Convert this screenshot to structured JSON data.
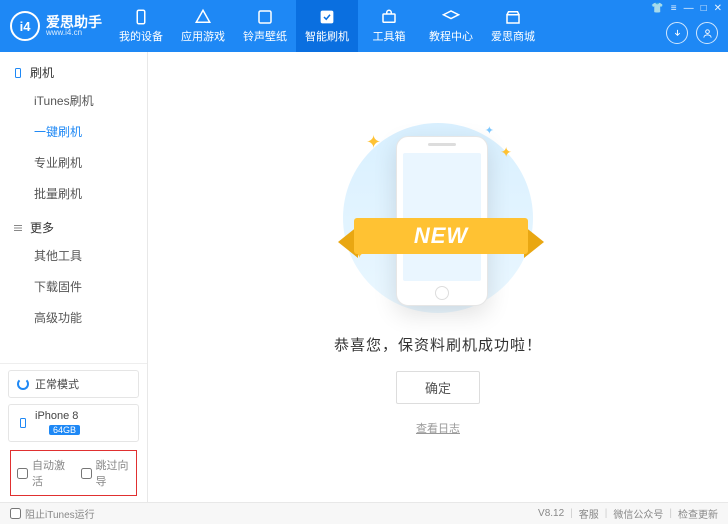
{
  "brand": {
    "title": "爱思助手",
    "sub": "www.i4.cn",
    "logo_text": "i4"
  },
  "nav": {
    "items": [
      {
        "label": "我的设备"
      },
      {
        "label": "应用游戏"
      },
      {
        "label": "铃声壁纸"
      },
      {
        "label": "智能刷机"
      },
      {
        "label": "工具箱"
      },
      {
        "label": "教程中心"
      },
      {
        "label": "爱思商城"
      }
    ]
  },
  "sidebar": {
    "group1": {
      "title": "刷机"
    },
    "items1": [
      {
        "label": "iTunes刷机"
      },
      {
        "label": "一键刷机"
      },
      {
        "label": "专业刷机"
      },
      {
        "label": "批量刷机"
      }
    ],
    "group2": {
      "title": "更多"
    },
    "items2": [
      {
        "label": "其他工具"
      },
      {
        "label": "下载固件"
      },
      {
        "label": "高级功能"
      }
    ],
    "mode_label": "正常模式",
    "device": {
      "name": "iPhone 8",
      "storage": "64GB"
    },
    "auto_activate": "自动激活",
    "skip_guide": "跳过向导"
  },
  "main": {
    "ribbon": "NEW",
    "message": "恭喜您，保资料刷机成功啦！",
    "ok": "确定",
    "view_log": "查看日志"
  },
  "footer": {
    "block_itunes": "阻止iTunes运行",
    "version": "V8.12",
    "support": "客服",
    "wechat": "微信公众号",
    "update": "检查更新"
  }
}
